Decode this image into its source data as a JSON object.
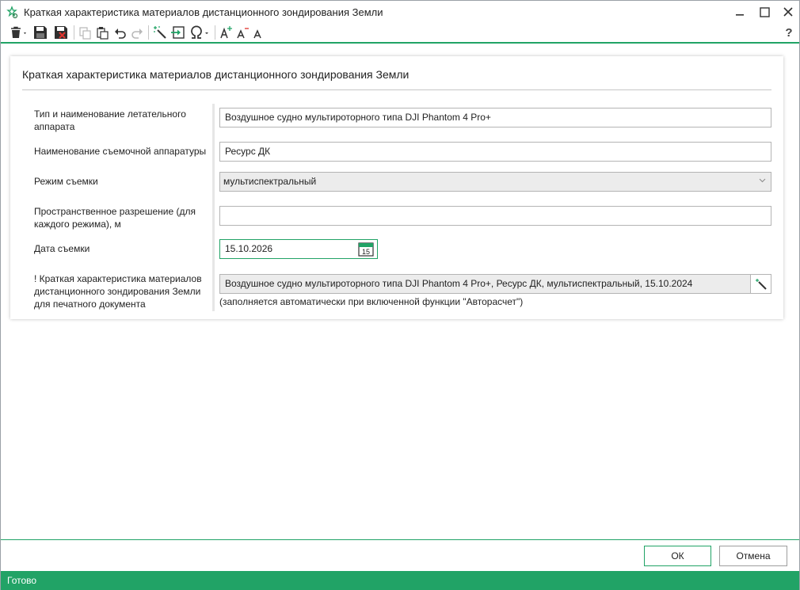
{
  "window": {
    "title": "Краткая характеристика материалов дистанционного зондирования Земли"
  },
  "toolbar": {
    "icons": [
      "delete-icon",
      "save-icon",
      "save-close-icon",
      "copy-icon",
      "paste-icon",
      "undo-icon",
      "redo-icon",
      "magic-wand-icon",
      "import-icon",
      "special-char-icon",
      "font-increase-icon",
      "font-decrease-icon",
      "font-reset-icon",
      "help-icon"
    ],
    "help_label": "?"
  },
  "card": {
    "title": "Краткая характеристика материалов дистанционного зондирования Земли",
    "fields": {
      "aircraft": {
        "label": "Тип и наименование летательного аппарата",
        "value": "Воздушное судно мультироторного типа DJI Phantom 4 Pro+"
      },
      "equipment": {
        "label": "Наименование съемочной аппаратуры",
        "value": "Ресурс ДК"
      },
      "mode": {
        "label": "Режим съемки",
        "value": "мультиспектральный"
      },
      "resolution": {
        "label": "Пространственное разрешение (для каждого режима), м",
        "value": ""
      },
      "date": {
        "label": "Дата съемки",
        "value": "15.10.2026",
        "calendar_day": "15"
      },
      "summary": {
        "label": "! Краткая характеристика материалов дистанционного зондирования Земли для печатного документа",
        "value": "Воздушное судно мультироторного типа DJI Phantom 4 Pro+, Ресурс ДК, мультиспектральный, 15.10.2024",
        "note": "(заполняется автоматически при включенной функции \"Авторасчет\")"
      }
    }
  },
  "buttons": {
    "ok": "ОК",
    "cancel": "Отмена"
  },
  "status": {
    "text": "Готово"
  },
  "colors": {
    "accent": "#21a366"
  }
}
